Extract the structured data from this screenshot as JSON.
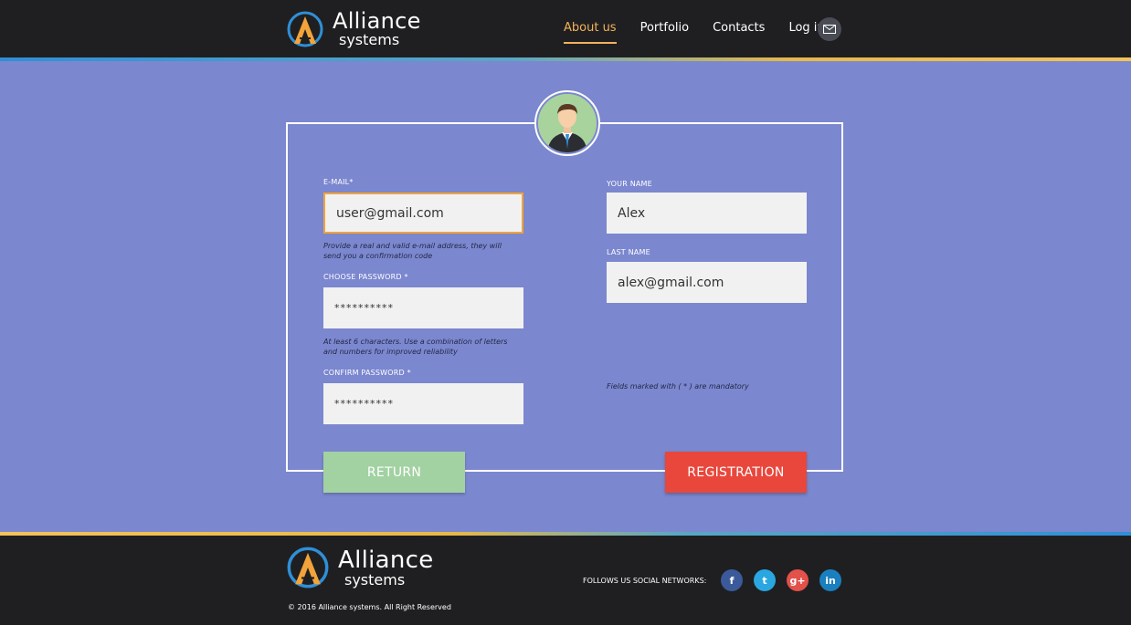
{
  "header": {
    "logo": {
      "title": "Alliance",
      "subtitle": "systems"
    },
    "nav": [
      "About us",
      "Portfolio",
      "Contacts",
      "Log in"
    ],
    "active_nav": "About us",
    "mail_icon": "envelope-icon"
  },
  "form": {
    "email": {
      "label": "E-MAIL*",
      "value": "user@gmail.com",
      "hint": "Provide a real and valid e-mail address, they will send you a confirmation code"
    },
    "password": {
      "label": "CHOOSE PASSWORD *",
      "value": "**********",
      "hint": "At least 6 characters. Use a combination of letters and numbers for improved reliability"
    },
    "confirm_password": {
      "label": "CONFIRM PASSWORD *",
      "value": "**********"
    },
    "your_name": {
      "label": "YOUR NAME",
      "value": "Alex"
    },
    "last_name": {
      "label": "LAST NAME",
      "value": "alex@gmail.com"
    },
    "mandatory_note": "Fields marked with ( * ) are mandatory",
    "return_label": "RETURN",
    "register_label": "REGISTRATION"
  },
  "footer": {
    "logo": {
      "title": "Alliance",
      "subtitle": "systems"
    },
    "social_label": "FOLLOWS US SOCIAL NETWORKS:",
    "social": [
      {
        "name": "facebook",
        "glyph": "f",
        "color": "#3b5a9a"
      },
      {
        "name": "twitter",
        "glyph": "t",
        "color": "#2aa6e0"
      },
      {
        "name": "google-plus",
        "glyph": "g+",
        "color": "#e2514a"
      },
      {
        "name": "linkedin",
        "glyph": "in",
        "color": "#1a7fbf"
      }
    ],
    "copyright": "© 2016 Alliance systems. All Right Reserved"
  },
  "colors": {
    "background": "#7b87cf",
    "accent": "#f2b25b",
    "return_button": "#a2d1a2",
    "register_button": "#e9473c"
  }
}
